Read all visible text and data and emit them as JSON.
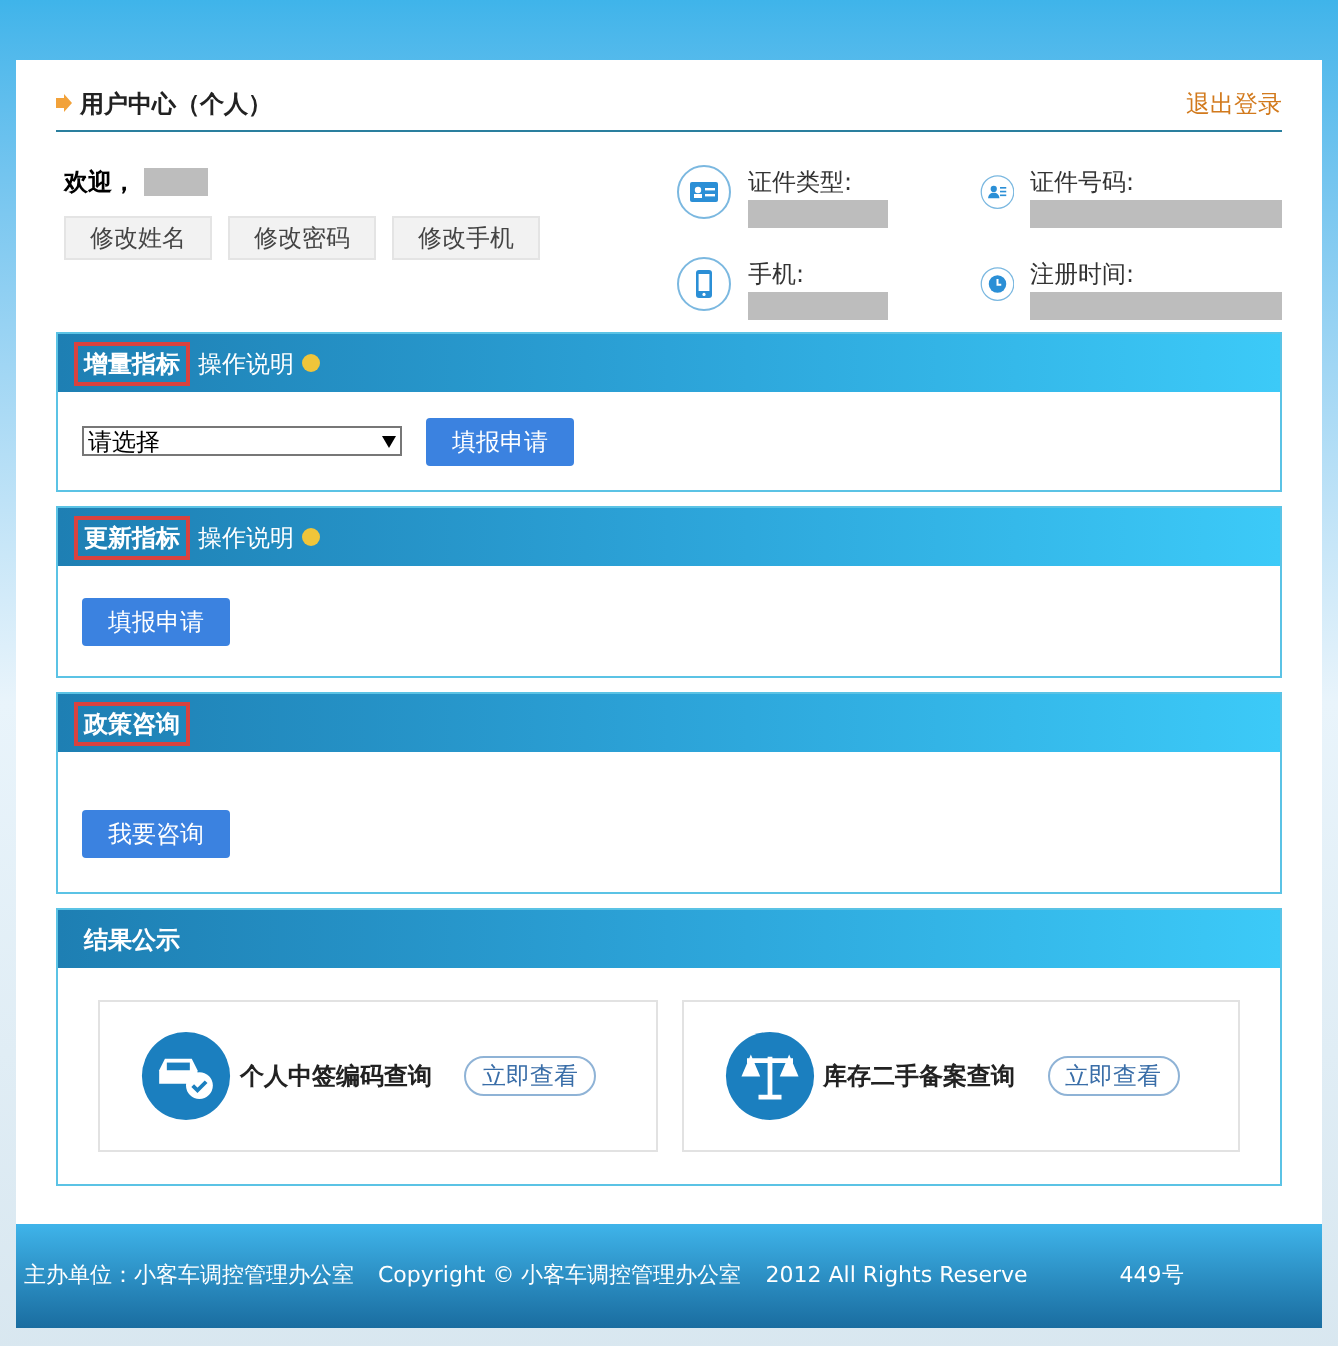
{
  "header": {
    "title": "用户中心（个人）",
    "logout": "退出登录"
  },
  "profile": {
    "welcome": "欢迎，",
    "buttons": [
      "修改姓名",
      "修改密码",
      "修改手机"
    ],
    "fields": [
      {
        "kind": "idcard",
        "label": "证件类型:"
      },
      {
        "kind": "person",
        "label": "证件号码:"
      },
      {
        "kind": "phone",
        "label": "手机:"
      },
      {
        "kind": "clock",
        "label": "注册时间:"
      }
    ]
  },
  "sections": [
    {
      "title": "增量指标",
      "highlighted": true,
      "help": "操作说明",
      "select": {
        "value": "请选择"
      },
      "button": "填报申请"
    },
    {
      "title": "更新指标",
      "highlighted": true,
      "help": "操作说明",
      "button": "填报申请"
    },
    {
      "title": "政策咨询",
      "highlighted": true,
      "button": "我要咨询"
    },
    {
      "title": "结果公示",
      "highlighted": false,
      "cards": [
        {
          "kind": "car",
          "label": "个人中签编码查询",
          "button": "立即查看"
        },
        {
          "kind": "scale",
          "label": "库存二手备案查询",
          "button": "立即查看"
        }
      ]
    }
  ],
  "footer": [
    "主办单位：小客车调控管理办公室",
    "Copyright © 小客车调控管理办公室",
    "2012  All Rights Reserve",
    "449号"
  ]
}
